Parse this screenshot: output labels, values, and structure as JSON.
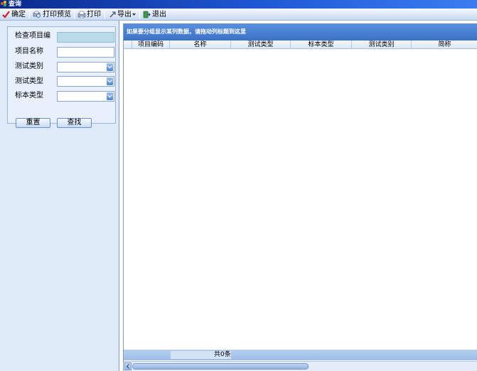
{
  "window": {
    "title": "查询"
  },
  "toolbar": {
    "confirm_label": "确定",
    "print_preview_label": "打印预览",
    "print_label": "打印",
    "export_label": "导出",
    "exit_label": "退出"
  },
  "filter": {
    "fields": [
      {
        "label": "检查项目编",
        "type": "text",
        "value": ""
      },
      {
        "label": "项目名称",
        "type": "text",
        "value": ""
      },
      {
        "label": "测试类别",
        "type": "select",
        "value": ""
      },
      {
        "label": "测试类型",
        "type": "select",
        "value": ""
      },
      {
        "label": "标本类型",
        "type": "select",
        "value": ""
      }
    ],
    "reset_label": "重置",
    "search_label": "查找"
  },
  "grid": {
    "group_hint": "如果要分组显示某列数据，请拖动列标题到这里",
    "columns": [
      "项目编码",
      "名称",
      "测试类型",
      "标本类型",
      "测试类别",
      "简称"
    ],
    "rows": [],
    "record_count": "共0条"
  },
  "colors": {
    "accent": "#3b72c9",
    "panel_bg": "#dfeaf8"
  }
}
